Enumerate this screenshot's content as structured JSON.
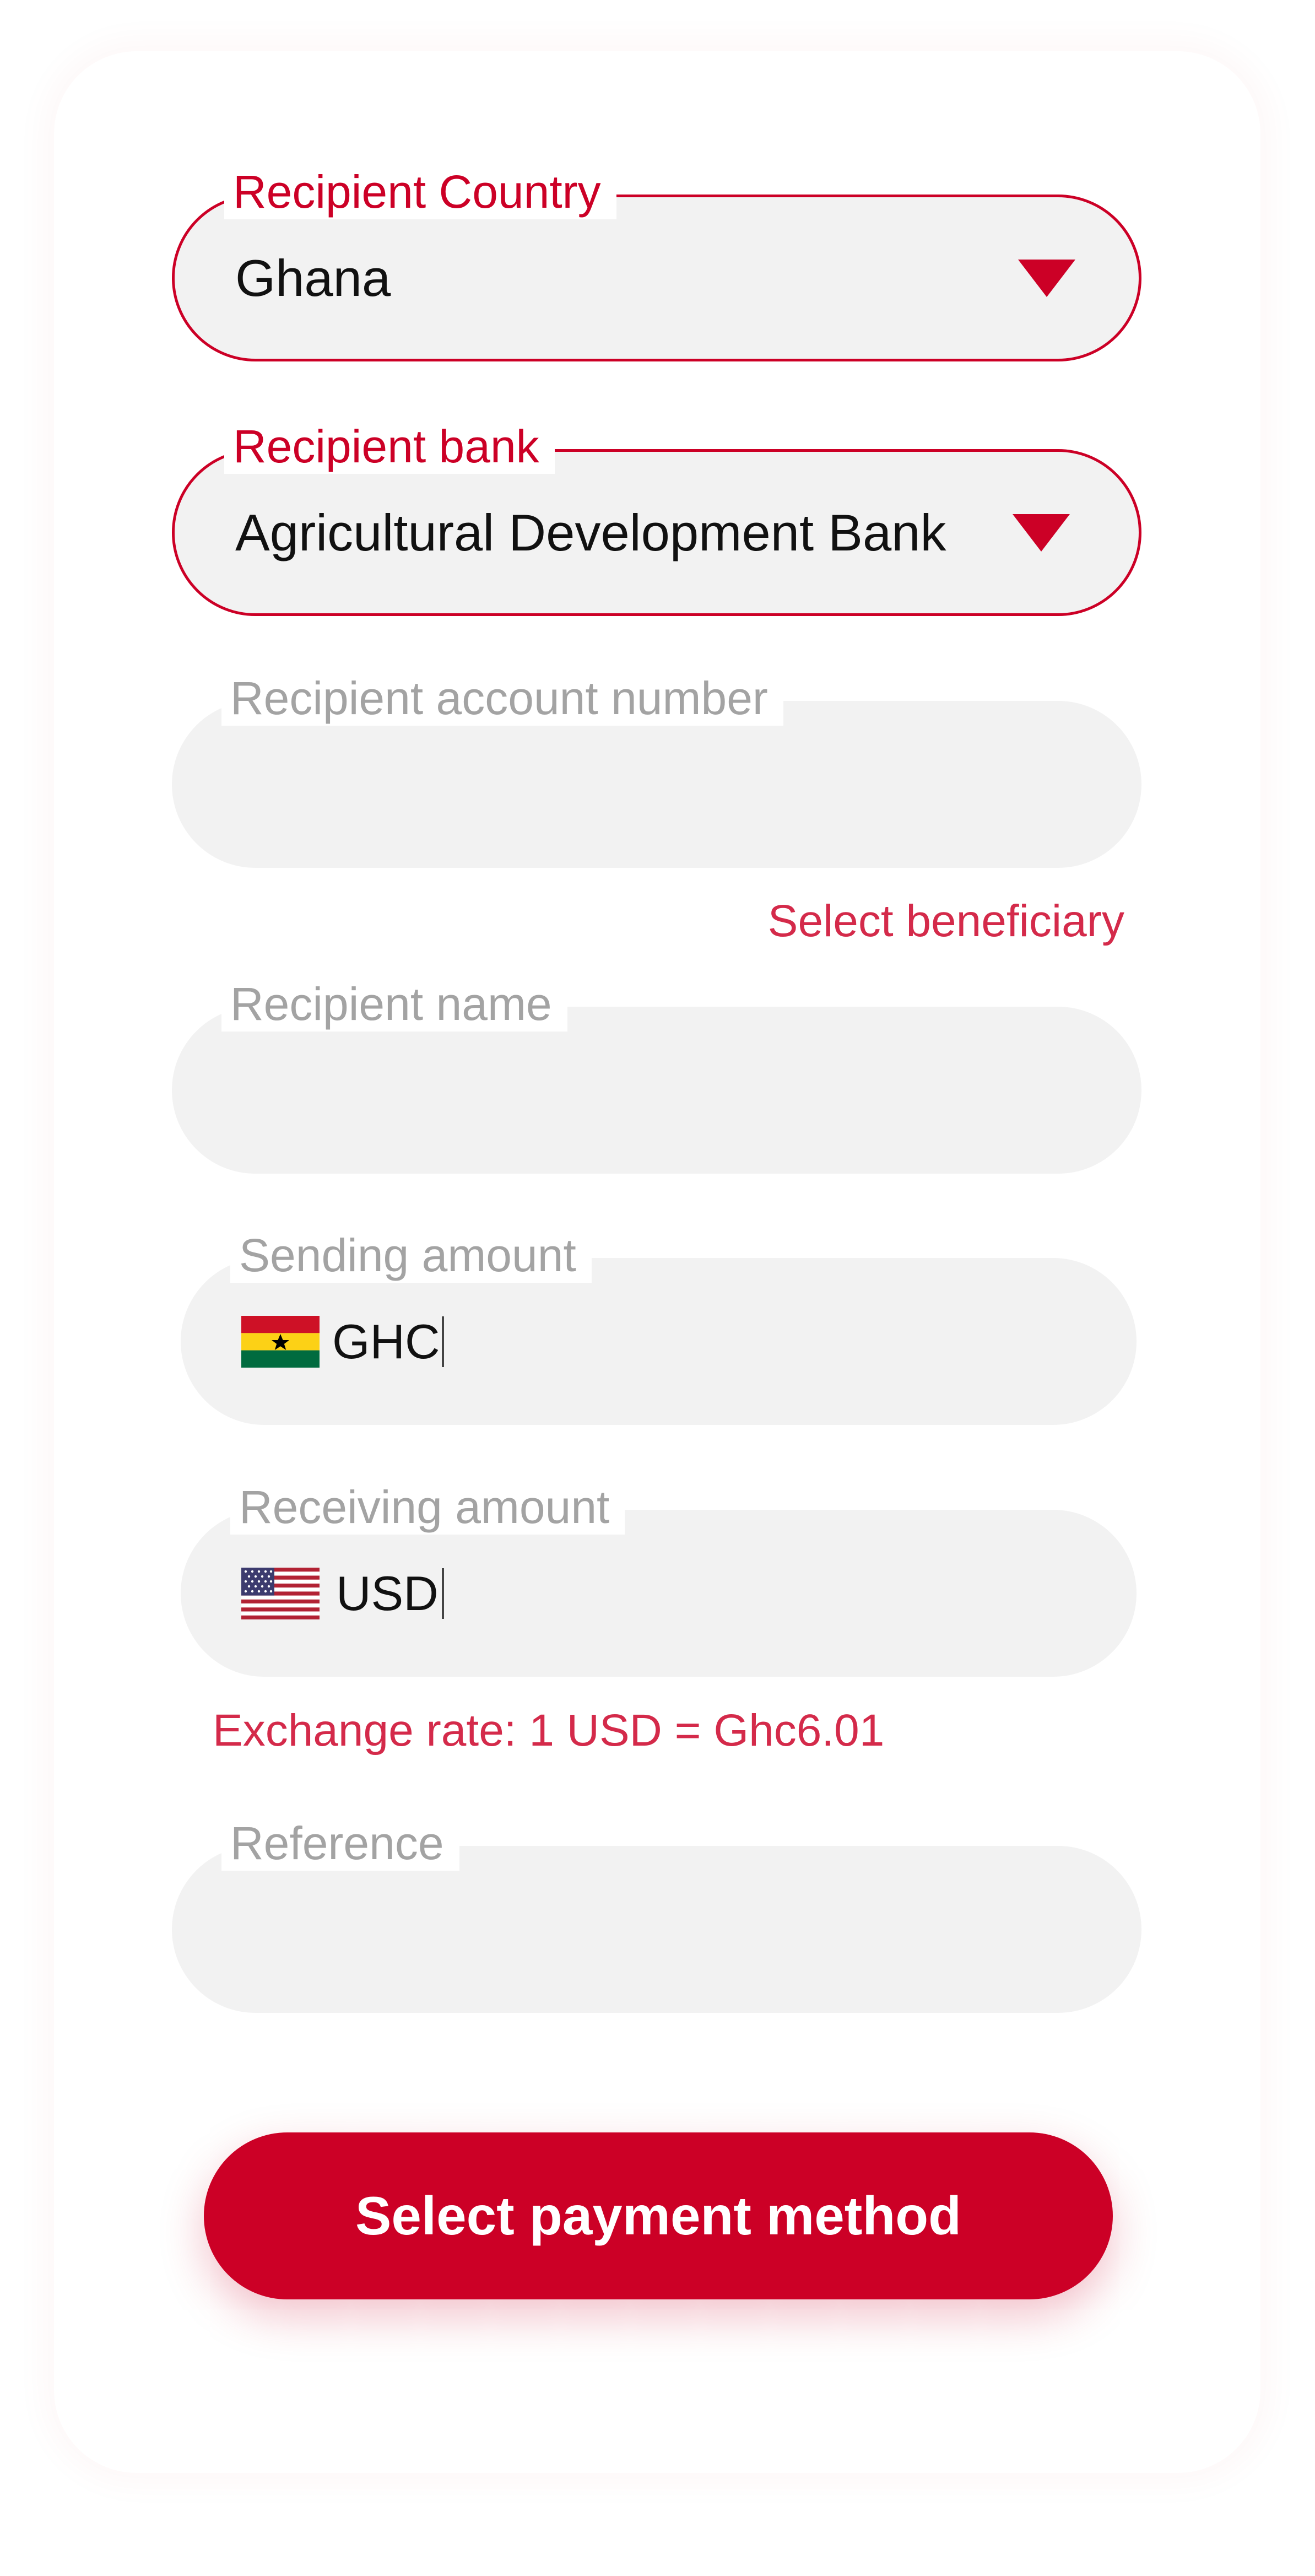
{
  "form": {
    "country": {
      "label": "Recipient Country",
      "value": "Ghana"
    },
    "bank": {
      "label": "Recipient bank",
      "value": "Agricultural Development Bank"
    },
    "account": {
      "label": "Recipient account number",
      "value": ""
    },
    "select_beneficiary": "Select beneficiary",
    "name": {
      "label": "Recipient name",
      "value": ""
    },
    "sending": {
      "label": "Sending amount",
      "currency": "GHC",
      "value": "",
      "flag": "ghana-flag-icon"
    },
    "receiving": {
      "label": "Receiving amount",
      "currency": "USD",
      "value": "",
      "flag": "usa-flag-icon"
    },
    "exchange_rate": "Exchange rate: 1 USD = Ghc6.01",
    "reference": {
      "label": "Reference",
      "value": ""
    }
  },
  "actions": {
    "submit_label": "Select payment method"
  },
  "colors": {
    "accent": "#cc0026",
    "field_bg": "#f2f2f2",
    "label_inactive": "#a3a3a3",
    "link": "#d42a4a"
  }
}
